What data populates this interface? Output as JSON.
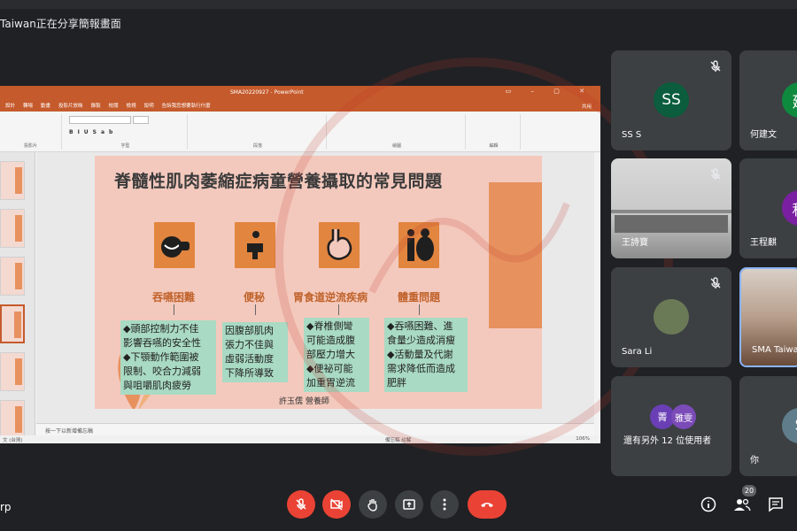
{
  "presenting_label": "Taiwan正在分享簡報畫面",
  "ppt": {
    "doc_title": "SMA20220927 - PowerPoint",
    "window_controls": "▭ – ▢ ✕",
    "tabs": [
      "設計",
      "轉場",
      "動畫",
      "投影片放映",
      "錄製",
      "校閱",
      "檢視",
      "說明",
      "告訴我您想要執行什麼"
    ],
    "share_label": "共用",
    "ribbon_groups": [
      "投影片",
      "字型",
      "段落",
      "繪圖",
      "編輯"
    ],
    "notes_placeholder": "按一下以新增備忘稿",
    "status_left": "文 (台灣)",
    "status_mid": "備忘稿  註解",
    "status_zoom": "106%"
  },
  "slide": {
    "title": "脊髓性肌肉萎縮症病童營養攝取的常見問題",
    "categories": [
      {
        "label": "吞嚥困難",
        "text": "◆頭部控制力不佳\n影響吞嚥的安全性\n◆下顎動作範圍被\n限制、咬合力減弱\n與咀嚼肌肉疲勞"
      },
      {
        "label": "便秘",
        "text": "因腹部肌肉\n張力不佳與\n虛弱活動度\n下降所導致"
      },
      {
        "label": "胃食道逆流疾病",
        "text": "◆脊椎側彎\n可能造成腹\n部壓力增大\n◆便祕可能\n加重胃逆流"
      },
      {
        "label": "體重問題",
        "text": "◆吞嚥困難、進\n食量少造成消瘦\n◆活動量及代謝\n需求降低而造成\n肥胖"
      }
    ],
    "author": "許玉儒 營養師"
  },
  "participants": [
    {
      "name": "SS S",
      "initials": "SS",
      "color": "#0b5d3e",
      "muted": true
    },
    {
      "name": "何建文",
      "initials": "建",
      "color": "#0e8a3e",
      "muted": false
    },
    {
      "name": "王詩寶",
      "initials": "",
      "color": "",
      "muted": true
    },
    {
      "name": "王程麒",
      "initials": "程",
      "color": "#7b1fa2",
      "muted": false
    },
    {
      "name": "Sara Li",
      "initials": "",
      "color": "",
      "muted": true
    },
    {
      "name": "SMA Taiwan",
      "initials": "",
      "color": "",
      "muted": false
    },
    {
      "name": "還有另外 12 位使用者",
      "initials": "菁",
      "initials2": "雅雯",
      "color": "#6a3fb5",
      "color2": "#7b4bb8",
      "muted": false
    },
    {
      "name": "你",
      "initials": "S",
      "color": "#607d8b",
      "muted": false
    }
  ],
  "bottom": {
    "meeting_code": "rp",
    "participant_count": "20"
  },
  "colors": {
    "accent_red": "#ea4335",
    "tile_bg": "#3c4043",
    "ppt_orange": "#c55a2c"
  }
}
